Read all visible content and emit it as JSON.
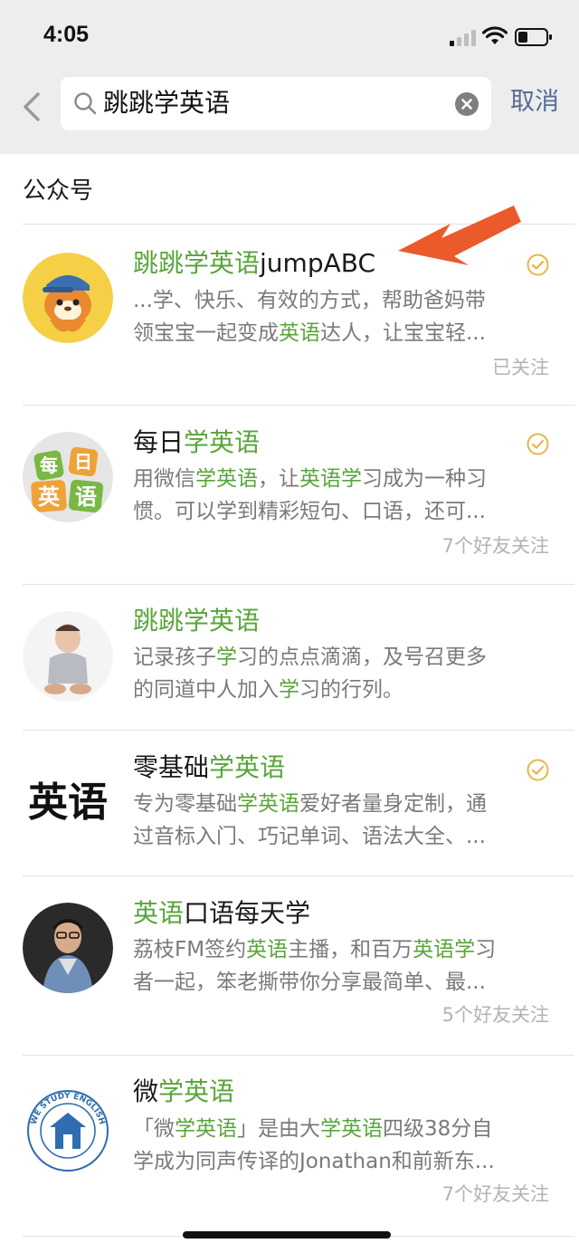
{
  "status": {
    "time": "4:05"
  },
  "search": {
    "query": "跳跳学英语",
    "cancel_label": "取消"
  },
  "section": {
    "title": "公众号"
  },
  "accounts": [
    {
      "name_parts": [
        {
          "t": "跳跳学英语",
          "hl": true
        },
        {
          "t": "jumpABC",
          "hl": false
        }
      ],
      "desc_lines": [
        [
          {
            "t": "...学、快乐、有效的方式，帮助爸妈带",
            "hl": false
          }
        ],
        [
          {
            "t": "领宝宝一起变成",
            "hl": false
          },
          {
            "t": "英语",
            "hl": true
          },
          {
            "t": "达人，让宝宝轻...",
            "hl": false
          }
        ]
      ],
      "follow": "已关注",
      "verified": true,
      "avatar_icon": "tiger-cartoon-icon"
    },
    {
      "name_parts": [
        {
          "t": "每日",
          "hl": false
        },
        {
          "t": "学英语",
          "hl": true
        }
      ],
      "desc_lines": [
        [
          {
            "t": "用微信",
            "hl": false
          },
          {
            "t": "学英语",
            "hl": true
          },
          {
            "t": "，让",
            "hl": false
          },
          {
            "t": "英语学",
            "hl": true
          },
          {
            "t": "习成为一种习",
            "hl": false
          }
        ],
        [
          {
            "t": "惯。可以学到精彩短句、口语，还可...",
            "hl": false
          }
        ]
      ],
      "follow": "7个好友关注",
      "verified": true,
      "avatar_icon": "daily-english-logo-icon",
      "avatar_text": [
        "每",
        "日",
        "英",
        "语"
      ]
    },
    {
      "name_parts": [
        {
          "t": "跳跳学英语",
          "hl": true
        }
      ],
      "desc_lines": [
        [
          {
            "t": "记录孩子",
            "hl": false
          },
          {
            "t": "学",
            "hl": true
          },
          {
            "t": "习的点点滴滴，及号召更多",
            "hl": false
          }
        ],
        [
          {
            "t": "的同道中人加入",
            "hl": false
          },
          {
            "t": "学",
            "hl": true
          },
          {
            "t": "习的行列。",
            "hl": false
          }
        ]
      ],
      "follow": "",
      "verified": false,
      "avatar_icon": "baby-photo-icon"
    },
    {
      "name_parts": [
        {
          "t": "零基础",
          "hl": false
        },
        {
          "t": "学英语",
          "hl": true
        }
      ],
      "desc_lines": [
        [
          {
            "t": "专为零基础",
            "hl": false
          },
          {
            "t": "学英语",
            "hl": true
          },
          {
            "t": "爱好者量身定制，通",
            "hl": false
          }
        ],
        [
          {
            "t": "过音标入门、巧记单词、语法大全、...",
            "hl": false
          }
        ]
      ],
      "follow": "",
      "verified": true,
      "avatar_icon": "english-text-logo-icon",
      "avatar_text": [
        "英语"
      ]
    },
    {
      "name_parts": [
        {
          "t": "英语",
          "hl": true
        },
        {
          "t": "口语每天学",
          "hl": false
        }
      ],
      "desc_lines": [
        [
          {
            "t": "荔枝FM签约",
            "hl": false
          },
          {
            "t": "英语",
            "hl": true
          },
          {
            "t": "主播，和百万",
            "hl": false
          },
          {
            "t": "英语学",
            "hl": true
          },
          {
            "t": "习",
            "hl": false
          }
        ],
        [
          {
            "t": "者一起，笨老撕带你分享最简单、最...",
            "hl": false
          }
        ]
      ],
      "follow": "5个好友关注",
      "verified": false,
      "avatar_icon": "man-portrait-icon"
    },
    {
      "name_parts": [
        {
          "t": "微",
          "hl": false
        },
        {
          "t": "学英语",
          "hl": true
        }
      ],
      "desc_lines": [
        [
          {
            "t": "「微",
            "hl": false
          },
          {
            "t": "学英语",
            "hl": true
          },
          {
            "t": "」是由大",
            "hl": false
          },
          {
            "t": "学英语",
            "hl": true
          },
          {
            "t": "四级38分自",
            "hl": false
          }
        ],
        [
          {
            "t": "学成为同声传译的Jonathan和前新东...",
            "hl": false
          }
        ]
      ],
      "follow": "7个好友关注",
      "verified": false,
      "avatar_icon": "we-study-english-badge-icon",
      "avatar_text": [
        "WE STUDY ENGLISH"
      ]
    }
  ],
  "colors": {
    "highlight": "#59a53a",
    "link": "#576b95",
    "verified": "#e9b44c",
    "annotation_arrow": "#ea5a2b"
  }
}
